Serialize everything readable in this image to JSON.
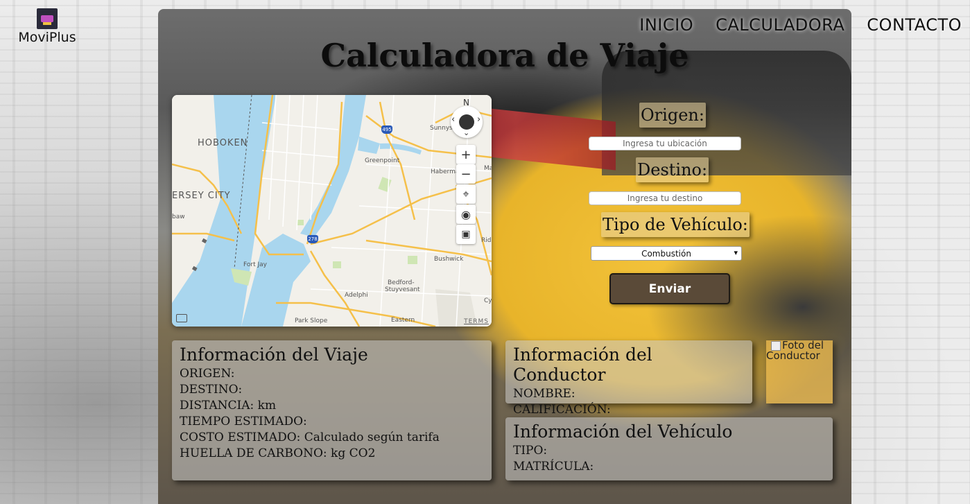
{
  "brand": {
    "name": "MoviPlus",
    "logo_icon": "moviplus-logo-icon"
  },
  "nav": {
    "items": [
      "INICIO",
      "CALCULADORA",
      "CONTACTO"
    ]
  },
  "page": {
    "title": "Calculadora de Viaje"
  },
  "map": {
    "labels": [
      "HOBOKEN",
      "ERSEY CITY",
      "Greenpoint",
      "Sunnys...",
      "Haberma...",
      "Fort Jay",
      "Bushwick",
      "Bedford-",
      "Stuyvesant",
      "Adelphi",
      "Park Slope",
      "Eastern",
      "Ridg",
      "Cy",
      "baw",
      "Ma"
    ],
    "highway_shields": [
      "495",
      "278"
    ],
    "compass_letter": "N",
    "zoom_in": "+",
    "zoom_out": "−",
    "terms": "TERMS",
    "colors": {
      "water": "#a9d6ee",
      "land": "#f2f0ea",
      "park": "#cfe6b4",
      "road": "#f5c04a"
    }
  },
  "form": {
    "origin_label": "Origen:",
    "origin_placeholder": "Ingresa tu ubicación",
    "destination_label": "Destino:",
    "destination_placeholder": "Ingresa tu destino",
    "vehicle_label": "Tipo de Vehículo:",
    "vehicle_selected": "Combustión",
    "submit_label": "Enviar"
  },
  "trip_info": {
    "title": "Información del Viaje",
    "rows": [
      "ORIGEN:",
      "DESTINO:",
      "DISTANCIA: km",
      "TIEMPO ESTIMADO:",
      "COSTO ESTIMADO: Calculado según tarifa",
      "HUELLA DE CARBONO: kg CO2"
    ]
  },
  "driver_info": {
    "title": "Información del Conductor",
    "rows": [
      "NOMBRE:",
      "CALIFICACIÓN:"
    ],
    "photo_alt": "Foto del Conductor"
  },
  "vehicle_info": {
    "title": "Información del Vehículo",
    "rows": [
      "TIPO:",
      "MATRÍCULA:"
    ]
  }
}
